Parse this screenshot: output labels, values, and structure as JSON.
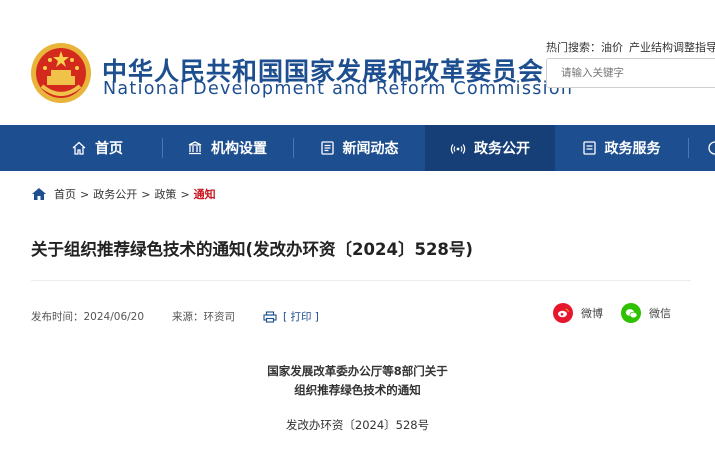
{
  "header": {
    "title_cn": "中华人民共和国国家发展和改革委员会",
    "title_en": "National Development and Reform Commission",
    "hot_label": "热门搜索：",
    "hot_items": [
      "油价",
      "产业结构调整指导目录"
    ],
    "search_placeholder": "请输入关键字"
  },
  "nav": {
    "items": [
      {
        "label": "首页",
        "icon": "home-icon"
      },
      {
        "label": "机构设置",
        "icon": "building-icon"
      },
      {
        "label": "新闻动态",
        "icon": "news-icon"
      },
      {
        "label": "政务公开",
        "icon": "broadcast-icon"
      },
      {
        "label": "政务服务",
        "icon": "service-icon"
      }
    ],
    "active_index": 3
  },
  "breadcrumb": {
    "items": [
      "首页",
      "政务公开",
      "政策"
    ],
    "current": "通知",
    "separator": ">"
  },
  "article": {
    "title": "关于组织推荐绿色技术的通知(发改办环资〔2024〕528号)",
    "publish_label": "发布时间：",
    "publish_date": "2024/06/20",
    "source_label": "来源：",
    "source": "环资司",
    "print_label": "[ 打印 ]",
    "share_weibo": "微博",
    "share_wechat": "微信",
    "doc_heading_line1": "国家发展改革委办公厅等8部门关于",
    "doc_heading_line2": "组织推荐绿色技术的通知",
    "doc_number": "发改办环资〔2024〕528号"
  },
  "colors": {
    "brand_blue": "#1d4e8f",
    "nav_active": "#163f77",
    "current_red": "#c8161d",
    "weibo_red": "#e6162d",
    "wechat_green": "#2dc100"
  }
}
